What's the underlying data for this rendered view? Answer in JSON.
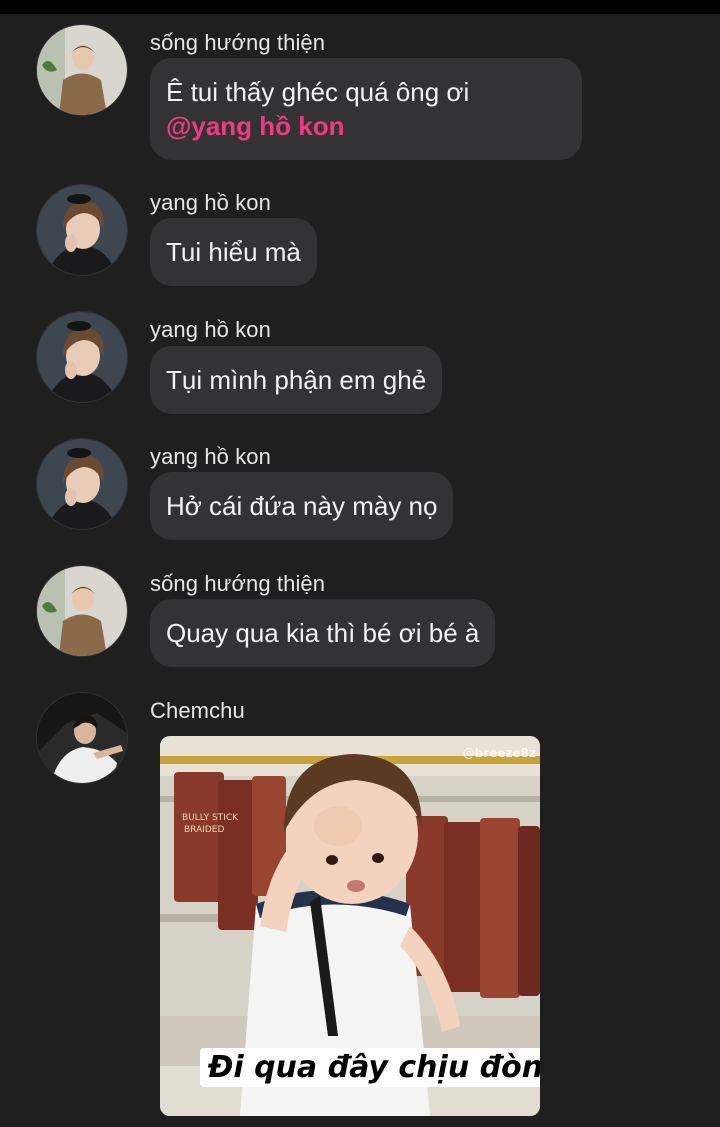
{
  "messages": [
    {
      "sender": "sống hướng thiện",
      "text": "Ê tui thấy ghéc quá ông ơi",
      "mention": "@yang hồ kon"
    },
    {
      "sender": "yang hồ kon",
      "text": "Tui hiểu mà"
    },
    {
      "sender": "yang hồ kon",
      "text": "Tụi mình phận em ghẻ"
    },
    {
      "sender": "yang hồ kon",
      "text": "Hở cái đứa này mày nọ"
    },
    {
      "sender": "sống hướng thiện",
      "text": "Quay qua kia thì bé ơi bé à"
    },
    {
      "sender": "Chemchu"
    }
  ],
  "meme": {
    "caption": "Đi qua đây chịu đòn",
    "watermark": "@breeze8z"
  },
  "colors": {
    "background": "#1f1f20",
    "bubble": "#333335",
    "mention": "#ec3b83"
  }
}
